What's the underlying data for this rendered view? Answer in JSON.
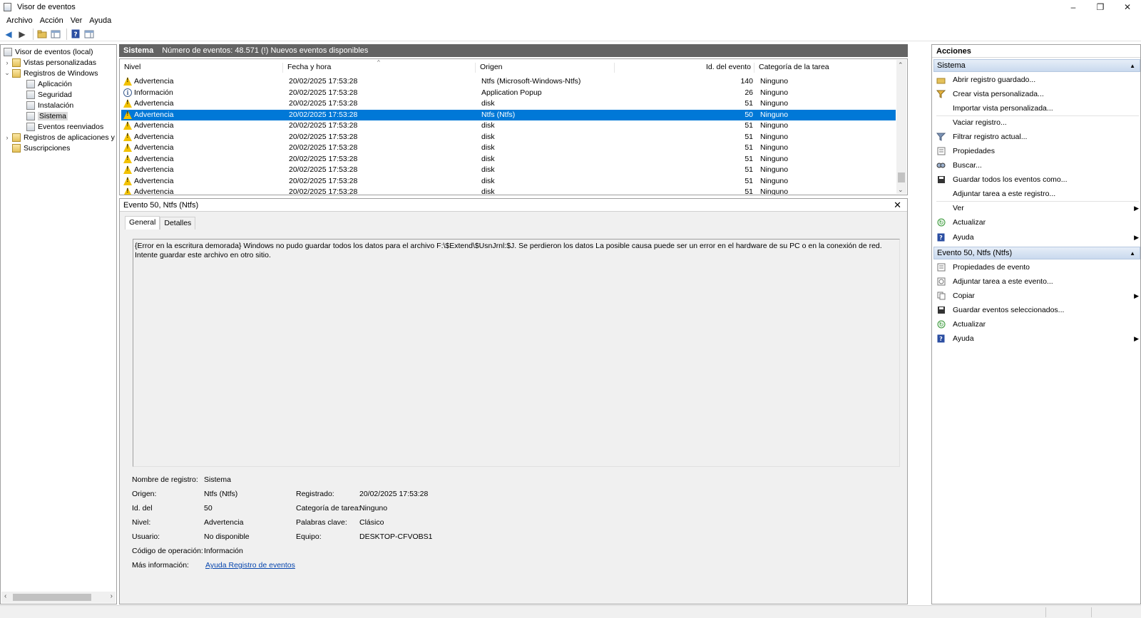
{
  "window": {
    "title": "Visor de eventos",
    "minimize": "–",
    "restore": "❐",
    "close": "✕"
  },
  "menu": [
    "Archivo",
    "Acción",
    "Ver",
    "Ayuda"
  ],
  "tree": {
    "items": [
      {
        "label": "Visor de eventos (local)"
      },
      {
        "label": "Vistas personalizadas"
      },
      {
        "label": "Registros de Windows"
      },
      {
        "label": "Aplicación"
      },
      {
        "label": "Seguridad"
      },
      {
        "label": "Instalación"
      },
      {
        "label": "Sistema"
      },
      {
        "label": "Eventos reenviados"
      },
      {
        "label": "Registros de aplicaciones y s"
      },
      {
        "label": "Suscripciones"
      }
    ]
  },
  "header": {
    "log_name": "Sistema",
    "summary": "Número de eventos: 48.571 (!) Nuevos eventos disponibles"
  },
  "columns": [
    "Nivel",
    "Fecha y hora",
    "Origen",
    "Id. del evento",
    "Categoría de la tarea"
  ],
  "events": [
    {
      "level": "Advertencia",
      "date": "20/02/2025 17:53:28",
      "source": "Ntfs (Microsoft-Windows-Ntfs)",
      "id": "140",
      "category": "Ninguno",
      "type": "warning"
    },
    {
      "level": "Información",
      "date": "20/02/2025 17:53:28",
      "source": "Application Popup",
      "id": "26",
      "category": "Ninguno",
      "type": "info"
    },
    {
      "level": "Advertencia",
      "date": "20/02/2025 17:53:28",
      "source": "disk",
      "id": "51",
      "category": "Ninguno",
      "type": "warning"
    },
    {
      "level": "Advertencia",
      "date": "20/02/2025 17:53:28",
      "source": "Ntfs (Ntfs)",
      "id": "50",
      "category": "Ninguno",
      "type": "warning"
    },
    {
      "level": "Advertencia",
      "date": "20/02/2025 17:53:28",
      "source": "disk",
      "id": "51",
      "category": "Ninguno",
      "type": "warning"
    },
    {
      "level": "Advertencia",
      "date": "20/02/2025 17:53:28",
      "source": "disk",
      "id": "51",
      "category": "Ninguno",
      "type": "warning"
    },
    {
      "level": "Advertencia",
      "date": "20/02/2025 17:53:28",
      "source": "disk",
      "id": "51",
      "category": "Ninguno",
      "type": "warning"
    },
    {
      "level": "Advertencia",
      "date": "20/02/2025 17:53:28",
      "source": "disk",
      "id": "51",
      "category": "Ninguno",
      "type": "warning"
    },
    {
      "level": "Advertencia",
      "date": "20/02/2025 17:53:28",
      "source": "disk",
      "id": "51",
      "category": "Ninguno",
      "type": "warning"
    },
    {
      "level": "Advertencia",
      "date": "20/02/2025 17:53:28",
      "source": "disk",
      "id": "51",
      "category": "Ninguno",
      "type": "warning"
    },
    {
      "level": "Advertencia",
      "date": "20/02/2025 17:53:28",
      "source": "disk",
      "id": "51",
      "category": "Ninguno",
      "type": "warning"
    }
  ],
  "selected_index": 3,
  "detail": {
    "title": "Evento 50, Ntfs (Ntfs)",
    "tabs": [
      "General",
      "Detalles"
    ],
    "message": "{Error en la escritura demorada} Windows no pudo guardar todos los datos para el archivo F:\\$Extend\\$UsnJrnl:$J. Se perdieron los datos La posible causa puede ser un error en el hardware de su PC o en la conexión de red. Intente guardar este archivo en otro sitio.",
    "fields": {
      "log_name_label": "Nombre de registro:",
      "log_name": "Sistema",
      "source_label": "Origen:",
      "source": "Ntfs (Ntfs)",
      "logged_label": "Registrado:",
      "logged": "20/02/2025 17:53:28",
      "id_label": "Id. del",
      "id": "50",
      "task_label": "Categoría de tarea:",
      "task": "Ninguno",
      "level_label": "Nivel:",
      "level": "Advertencia",
      "keywords_label": "Palabras clave:",
      "keywords": "Clásico",
      "user_label": "Usuario:",
      "user": "No disponible",
      "computer_label": "Equipo:",
      "computer": "DESKTOP-CFVOBS1",
      "opcode_label": "Código de operación:",
      "opcode": "Información",
      "more_label": "Más información:",
      "more_link": "Ayuda Registro de eventos"
    }
  },
  "actions": {
    "title": "Acciones",
    "section1": "Sistema",
    "section1_items": [
      "Abrir registro guardado...",
      "Crear vista personalizada...",
      "Importar vista personalizada...",
      "Vaciar registro...",
      "Filtrar registro actual...",
      "Propiedades",
      "Buscar...",
      "Guardar todos los eventos como...",
      "Adjuntar tarea a este registro...",
      "Ver",
      "Actualizar",
      "Ayuda"
    ],
    "section2": "Evento 50, Ntfs (Ntfs)",
    "section2_items": [
      "Propiedades de evento",
      "Adjuntar tarea a este evento...",
      "Copiar",
      "Guardar eventos seleccionados...",
      "Actualizar",
      "Ayuda"
    ]
  }
}
